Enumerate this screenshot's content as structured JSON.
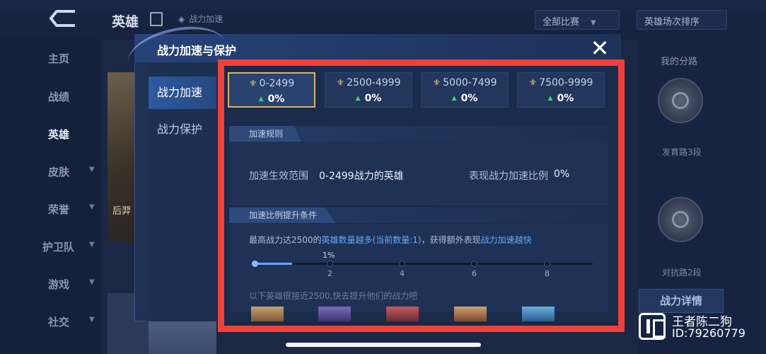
{
  "header": {
    "title": "英雄",
    "power_tab": "战力加速",
    "filter_select": "全部比赛",
    "sort_select": "英雄场次排序"
  },
  "left_nav": {
    "items": [
      {
        "label": "主页"
      },
      {
        "label": "战绩"
      },
      {
        "label": "英雄"
      },
      {
        "label": "皮肤"
      },
      {
        "label": "荣誉"
      },
      {
        "label": "护卫队"
      },
      {
        "label": "游戏"
      },
      {
        "label": "社交"
      }
    ]
  },
  "hero_card": {
    "name": "后羿"
  },
  "right_panel": {
    "title": "我的分路",
    "rank1": "发育路3段",
    "rank2": "对抗路2段",
    "detail_button": "战力详情"
  },
  "modal": {
    "title": "战力加速与保护",
    "close_symbol": "✕",
    "side_tabs": [
      {
        "label": "战力加速"
      },
      {
        "label": "战力保护"
      }
    ],
    "tiers": [
      {
        "range": "0-2499",
        "value": "0%"
      },
      {
        "range": "2500-4999",
        "value": "0%"
      },
      {
        "range": "5000-7499",
        "value": "0%"
      },
      {
        "range": "7500-9999",
        "value": "0%"
      }
    ],
    "rules": {
      "section_title": "加速规则",
      "scope_label": "加速生效范围",
      "scope_value": "0-2499战力的英雄",
      "ratio_label": "表现战力加速比例",
      "ratio_value": "0%"
    },
    "conditions": {
      "section_title": "加速比例提升条件",
      "text_a": "最高战力达2500的",
      "text_b": "英雄数量越多(当前数量:1)",
      "text_c": "，获得额外表现",
      "text_d": "战力加速越快",
      "progress_fraction": 0.11,
      "progress_label": "1%",
      "ticks": [
        "2",
        "4",
        "6",
        "8"
      ],
      "hint": "以下英雄很接近2500,快去提升他们的战力吧"
    }
  },
  "watermark": {
    "name": "王者陈二狗",
    "id": "ID:79260779"
  },
  "colors": {
    "highlight": "#f0403a",
    "accent": "#5fa8ff",
    "gold": "#d6b46a",
    "up_arrow": "#3ed07a"
  }
}
